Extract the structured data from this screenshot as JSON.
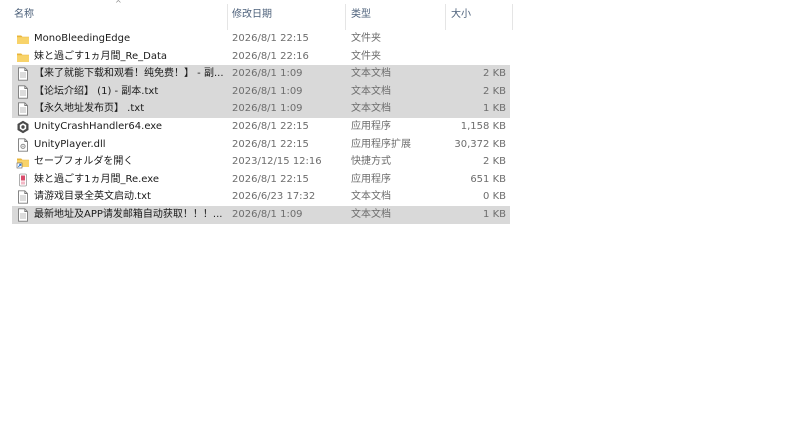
{
  "columns": {
    "name": "名称",
    "date": "修改日期",
    "type": "类型",
    "size": "大小"
  },
  "files": [
    {
      "name": "MonoBleedingEdge",
      "date": "2026/8/1 22:15",
      "type": "文件夹",
      "size": "",
      "icon": "folder-icon",
      "selected": false
    },
    {
      "name": "妹と過ごす1ヵ月間_Re_Data",
      "date": "2026/8/1 22:16",
      "type": "文件夹",
      "size": "",
      "icon": "folder-icon",
      "selected": false
    },
    {
      "name": "【来了就能下载和观看！纯免费！】 - 副...",
      "date": "2026/8/1 1:09",
      "type": "文本文档",
      "size": "2 KB",
      "icon": "text-file-icon",
      "selected": true
    },
    {
      "name": "【论坛介绍】 (1) - 副本.txt",
      "date": "2026/8/1 1:09",
      "type": "文本文档",
      "size": "2 KB",
      "icon": "text-file-icon",
      "selected": true
    },
    {
      "name": "【永久地址发布页】 .txt",
      "date": "2026/8/1 1:09",
      "type": "文本文档",
      "size": "1 KB",
      "icon": "text-file-icon",
      "selected": true
    },
    {
      "name": "UnityCrashHandler64.exe",
      "date": "2026/8/1 22:15",
      "type": "应用程序",
      "size": "1,158 KB",
      "icon": "unity-exe-icon",
      "selected": false
    },
    {
      "name": "UnityPlayer.dll",
      "date": "2026/8/1 22:15",
      "type": "应用程序扩展",
      "size": "30,372 KB",
      "icon": "dll-file-icon",
      "selected": false
    },
    {
      "name": "セーブフォルダを開く",
      "date": "2023/12/15 12:16",
      "type": "快捷方式",
      "size": "2 KB",
      "icon": "shortcut-icon",
      "selected": false
    },
    {
      "name": "妹と過ごす1ヵ月間_Re.exe",
      "date": "2026/8/1 22:15",
      "type": "应用程序",
      "size": "651 KB",
      "icon": "game-exe-icon",
      "selected": false
    },
    {
      "name": "请游戏目录全英文启动.txt",
      "date": "2026/6/23 17:32",
      "type": "文本文档",
      "size": "0 KB",
      "icon": "text-file-icon",
      "selected": false
    },
    {
      "name": "最新地址及APP请发邮箱自动获取！！！...",
      "date": "2026/8/1 1:09",
      "type": "文本文档",
      "size": "1 KB",
      "icon": "text-file-icon",
      "selected": true
    }
  ]
}
